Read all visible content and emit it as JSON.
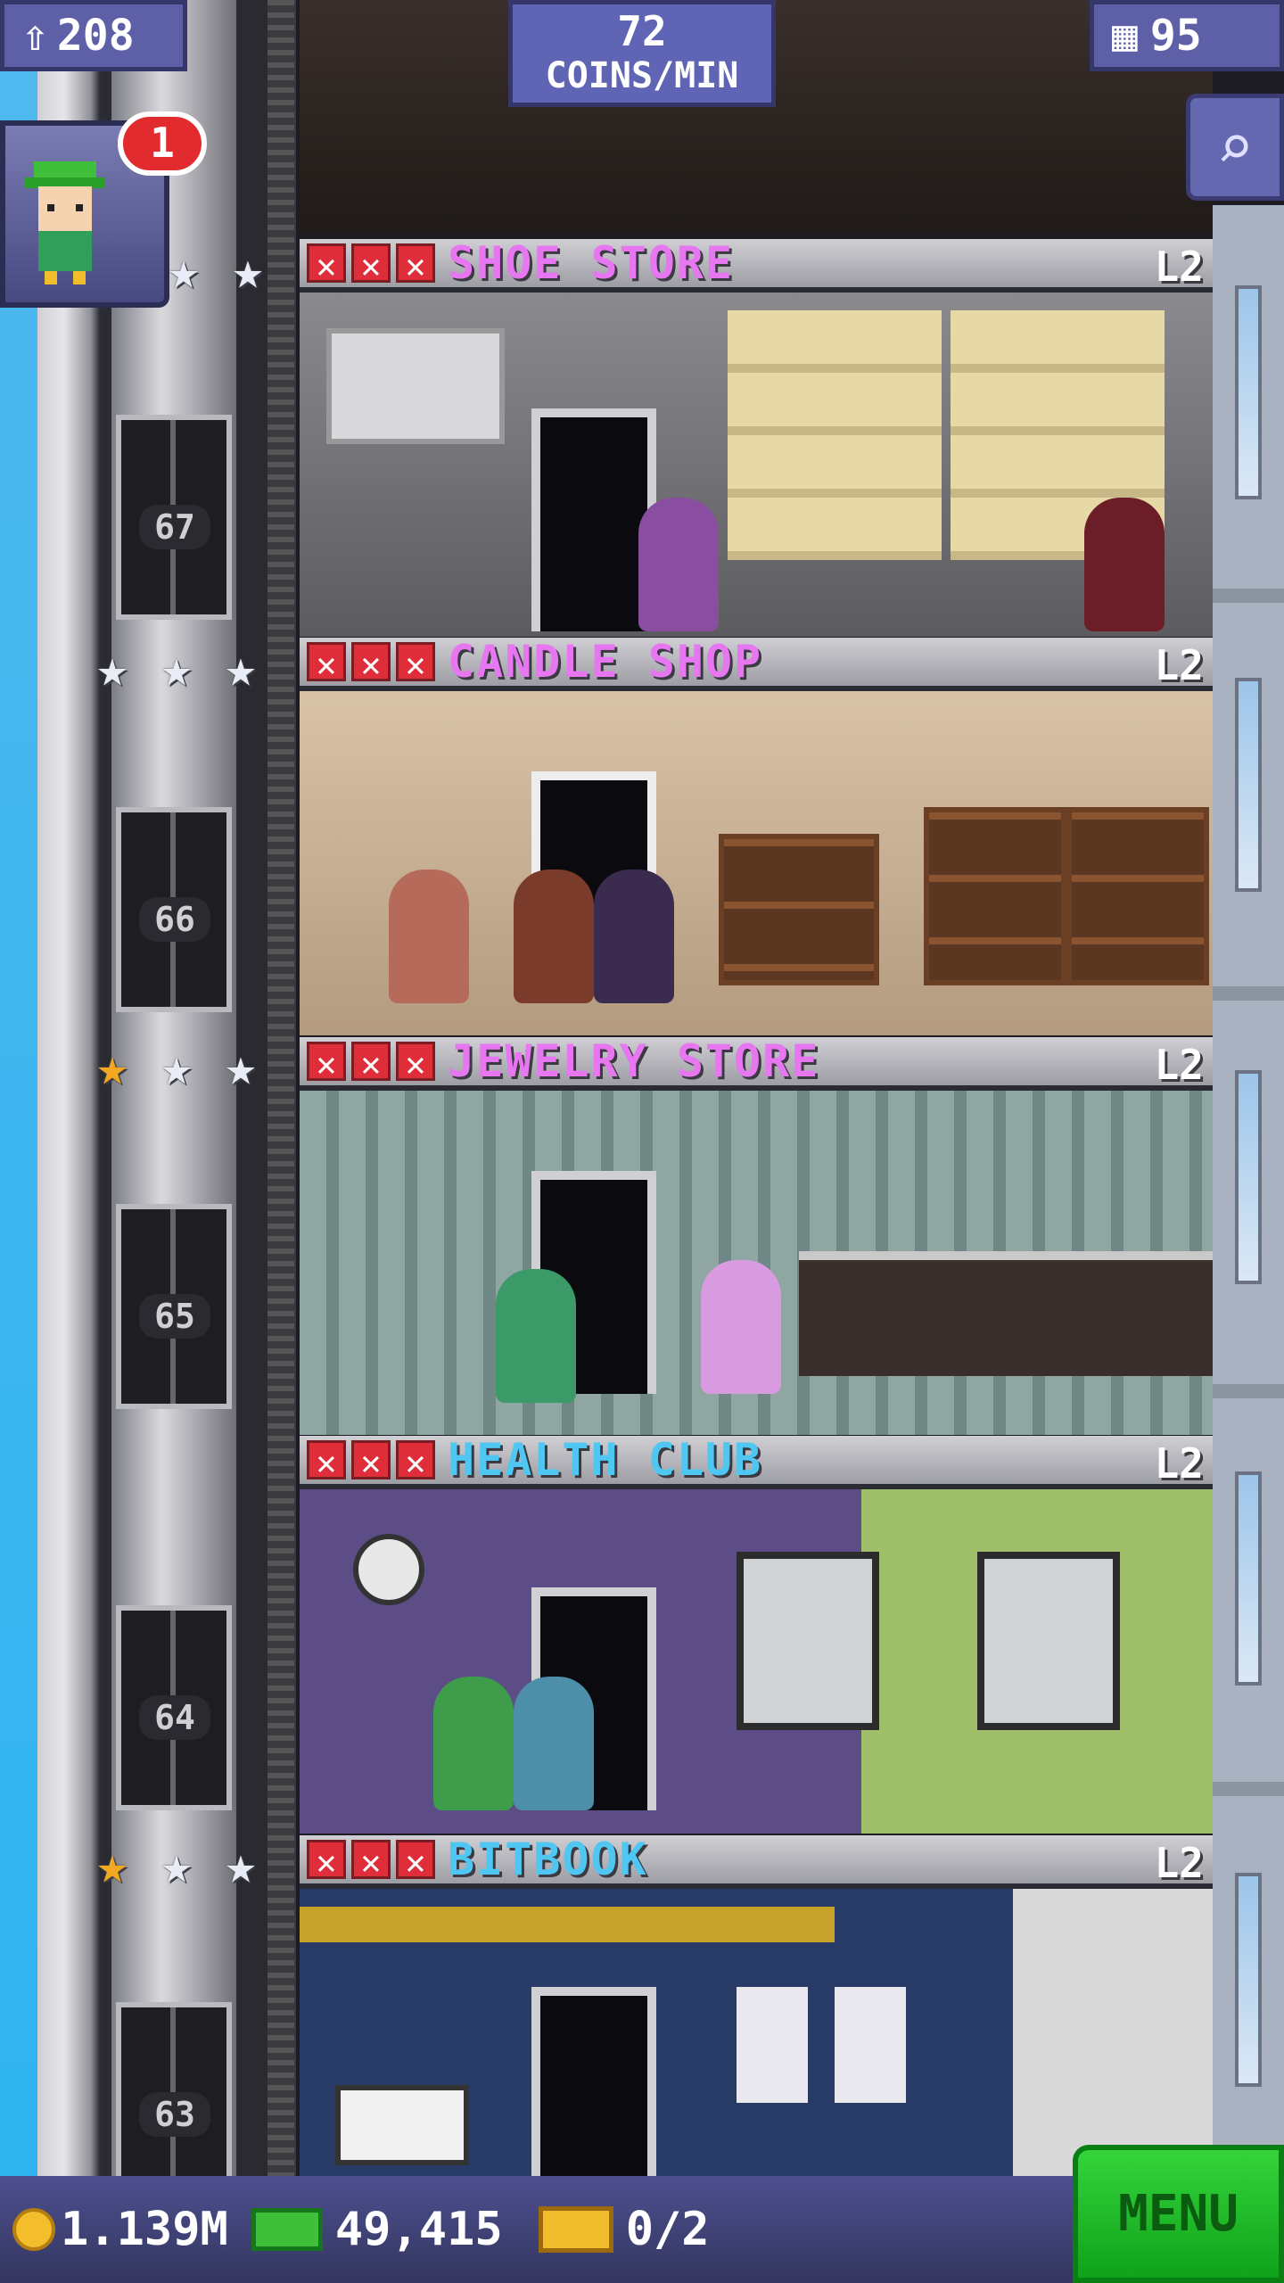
{
  "hud": {
    "population": "208",
    "coins_rate_value": "72",
    "coins_rate_unit": "COINS/MIN",
    "floors": "95"
  },
  "notification": {
    "count": "1"
  },
  "floors": [
    {
      "name": "SHOE STORE",
      "level": "L2",
      "elevator_floor": "67",
      "name_color": "#e677f0",
      "stars": [
        "silver",
        "silver"
      ]
    },
    {
      "name": "CANDLE SHOP",
      "level": "L2",
      "elevator_floor": "66",
      "name_color": "#e677f0",
      "stars": [
        "silver",
        "silver",
        "silver"
      ]
    },
    {
      "name": "JEWELRY STORE",
      "level": "L2",
      "elevator_floor": "65",
      "name_color": "#e677f0",
      "stars": [
        "gold",
        "silver",
        "silver"
      ]
    },
    {
      "name": "HEALTH CLUB",
      "level": "L2",
      "elevator_floor": "64",
      "name_color": "#4fc7f2",
      "stars": []
    },
    {
      "name": "BITBOOK",
      "level": "L2",
      "elevator_floor": "63",
      "name_color": "#4fc7f2",
      "stars": [
        "gold",
        "silver",
        "silver"
      ]
    }
  ],
  "bottom": {
    "coins": "1.139M",
    "bux": "49,415",
    "tickets": "0/2",
    "menu_label": "MENU"
  },
  "icons": {
    "population": "person-up-icon",
    "floors": "building-icon",
    "search": "magnifier-icon",
    "coin": "coin-icon",
    "bux": "tower-bux-icon",
    "ticket": "vip-ticket-icon"
  }
}
